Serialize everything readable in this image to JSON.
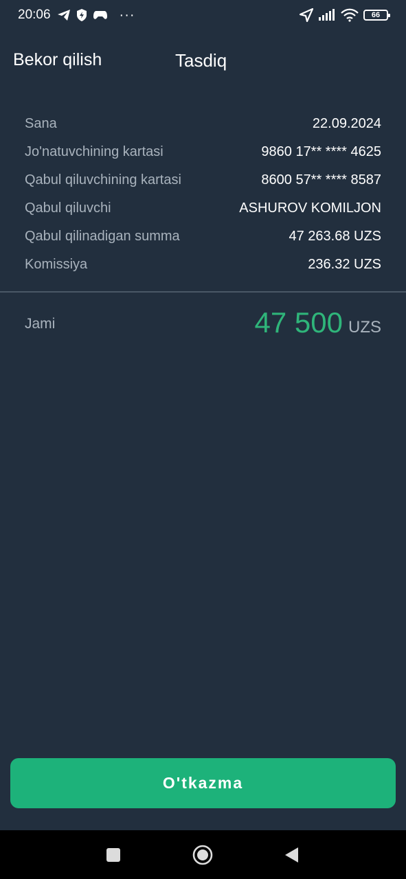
{
  "status_bar": {
    "time": "20:06",
    "more": "···",
    "battery": "66",
    "icons": [
      "telegram-icon",
      "shield-bolt-icon",
      "gamepad-icon",
      "location-arrow-icon",
      "signal-icon",
      "wifi-icon",
      "battery-icon"
    ]
  },
  "header": {
    "cancel_label": "Bekor qilish",
    "title": "Tasdiq"
  },
  "details": [
    {
      "label": "Sana",
      "value": "22.09.2024"
    },
    {
      "label": "Jo'natuvchining kartasi",
      "value": "9860 17** **** 4625"
    },
    {
      "label": "Qabul qiluvchining kartasi",
      "value": "8600 57** **** 8587"
    },
    {
      "label": "Qabul qiluvchi",
      "value": "ASHUROV KOMILJON"
    },
    {
      "label": "Qabul qilinadigan summa",
      "value": "47 263.68 UZS"
    },
    {
      "label": "Komissiya",
      "value": "236.32 UZS"
    }
  ],
  "total": {
    "label": "Jami",
    "amount": "47 500",
    "currency": "UZS"
  },
  "actions": {
    "submit_label": "O'tkazma"
  },
  "nav": {
    "icons": [
      "square-recents-icon",
      "circle-home-icon",
      "triangle-back-icon"
    ]
  },
  "colors": {
    "background": "#222f3e",
    "accent": "#1db27a",
    "amount": "#2fb57a",
    "label": "#a9b3bd"
  }
}
